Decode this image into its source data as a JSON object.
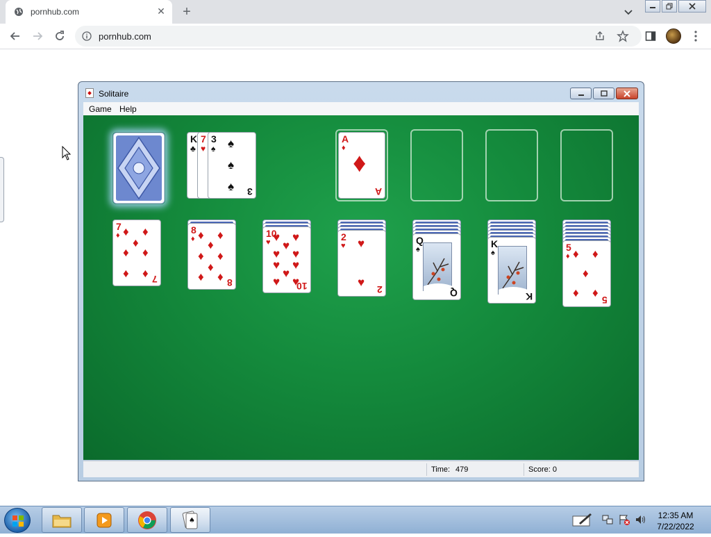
{
  "browser": {
    "tab_title": "pornhub.com",
    "url": "pornhub.com"
  },
  "solitaire": {
    "window_title": "Solitaire",
    "menu": [
      "Game",
      "Help"
    ],
    "status": {
      "time_label": "Time:",
      "time_value": "479",
      "score": "Score: 0"
    },
    "waste": [
      {
        "rank": "K",
        "suit": "clubs"
      },
      {
        "rank": "7",
        "suit": "hearts"
      },
      {
        "rank": "3",
        "suit": "spades"
      }
    ],
    "foundations": [
      {
        "rank": "A",
        "suit": "diamonds"
      },
      null,
      null,
      null
    ],
    "tableau": [
      {
        "hidden": 0,
        "top": {
          "rank": "7",
          "suit": "diamonds"
        }
      },
      {
        "hidden": 1,
        "top": {
          "rank": "8",
          "suit": "diamonds"
        }
      },
      {
        "hidden": 2,
        "top": {
          "rank": "10",
          "suit": "hearts"
        }
      },
      {
        "hidden": 3,
        "top": {
          "rank": "2",
          "suit": "hearts"
        }
      },
      {
        "hidden": 4,
        "top": {
          "rank": "Q",
          "suit": "spades"
        }
      },
      {
        "hidden": 5,
        "top": {
          "rank": "K",
          "suit": "spades"
        }
      },
      {
        "hidden": 6,
        "top": {
          "rank": "5",
          "suit": "diamonds"
        }
      }
    ]
  },
  "taskbar": {
    "time": "12:35 AM",
    "date": "7/22/2022",
    "apps": [
      "file-explorer",
      "media-player",
      "chrome",
      "solitaire"
    ]
  }
}
